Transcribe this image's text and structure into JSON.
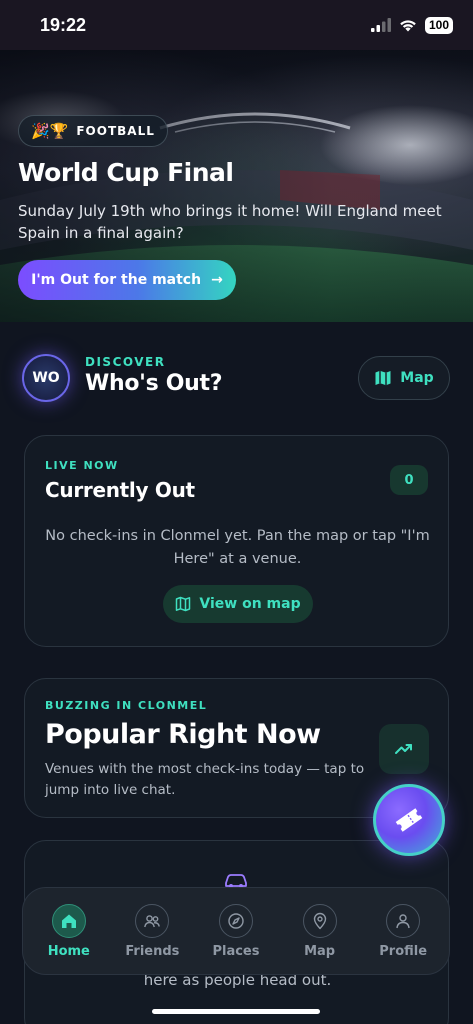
{
  "status_bar": {
    "time": "19:22",
    "battery": "100"
  },
  "hero": {
    "chip_emoji": "🎉🏆",
    "chip_label": "FOOTBALL",
    "title": "World Cup Final",
    "description": "Sunday July 19th who brings it home! Will England meet Spain in a final again?",
    "cta_label": "I'm Out for the match",
    "cta_arrow": "→"
  },
  "discover": {
    "logo_text": "WO",
    "eyebrow": "DISCOVER",
    "title": "Who's Out?",
    "map_button_label": "Map"
  },
  "live_card": {
    "eyebrow": "LIVE NOW",
    "title": "Currently Out",
    "count": "0",
    "empty_text": "No check-ins in Clonmel yet. Pan the map or tap \"I'm Here\" at a venue.",
    "view_map_label": "View on map"
  },
  "popular_card": {
    "eyebrow": "BUZZING IN CLONMEL",
    "title": "Popular Right Now",
    "description": "Venues with the most check-ins today — tap to jump into live chat."
  },
  "third_card": {
    "partial_text": "here as people head out."
  },
  "tabbar": {
    "items": [
      {
        "label": "Home",
        "icon": "home-icon",
        "active": true
      },
      {
        "label": "Friends",
        "icon": "friends-icon",
        "active": false
      },
      {
        "label": "Places",
        "icon": "compass-icon",
        "active": false
      },
      {
        "label": "Map",
        "icon": "map-pin-icon",
        "active": false
      },
      {
        "label": "Profile",
        "icon": "profile-icon",
        "active": false
      }
    ]
  },
  "colors": {
    "accent_teal": "#3fe0c0",
    "accent_purple": "#7c4dff",
    "background": "#101520",
    "card": "#131a24"
  }
}
